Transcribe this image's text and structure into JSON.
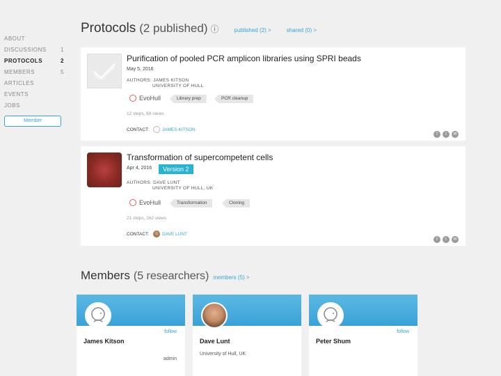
{
  "sidebar": {
    "items": [
      {
        "label": "ABOUT",
        "count": ""
      },
      {
        "label": "DISCUSSIONS",
        "count": "1"
      },
      {
        "label": "PROTOCOLS",
        "count": "2"
      },
      {
        "label": "MEMBERS",
        "count": "5"
      },
      {
        "label": "ARTICLES",
        "count": ""
      },
      {
        "label": "EVENTS",
        "count": ""
      },
      {
        "label": "JOBS",
        "count": ""
      }
    ],
    "member_button": "Member"
  },
  "header": {
    "title": "Protocols",
    "subtitle": "(2 published)",
    "info_icon": "info-circle-icon",
    "link_published": "published (2) >",
    "link_shared": "shared (0) >"
  },
  "protocols": [
    {
      "title": "Purification of pooled PCR amplicon libraries using SPRI beads",
      "date": "May 5, 2016",
      "authors_label": "AUTHORS: JAMES KITSON",
      "affiliation": "UNIVERSITY OF HULL",
      "group": "EvoHull",
      "tags": [
        "Library prep",
        "PCR cleanup"
      ],
      "stats": "12 steps, 69 views",
      "contact_label": "CONTACT:",
      "contact_name": "JAMES KITSON",
      "version": ""
    },
    {
      "title": "Transformation of supercompetent cells",
      "date": "Apr 4, 2016",
      "authors_label": "AUTHORS: DAVE LUNT",
      "affiliation": "UNIVERSITY OF HULL, UK",
      "group": "EvoHull",
      "tags": [
        "Transformation",
        "Cloning"
      ],
      "stats": "21 steps, 162 views",
      "contact_label": "CONTACT:",
      "contact_name": "DAVE LUNT",
      "version": "Version 2"
    }
  ],
  "members_section": {
    "title": "Members",
    "subtitle": "(5 researchers)",
    "link": "members (5) >",
    "cards": [
      {
        "name": "James Kitson",
        "follow": "follow",
        "affiliation": "",
        "role": "admin"
      },
      {
        "name": "Dave Lunt",
        "follow": "",
        "affiliation": "University of Hull, UK",
        "role": ""
      },
      {
        "name": "Peter Shum",
        "follow": "follow",
        "affiliation": "",
        "role": ""
      }
    ]
  },
  "colors": {
    "accent": "#33a6d6",
    "version_badge": "#29b3d2",
    "band": "#4aaedc"
  }
}
